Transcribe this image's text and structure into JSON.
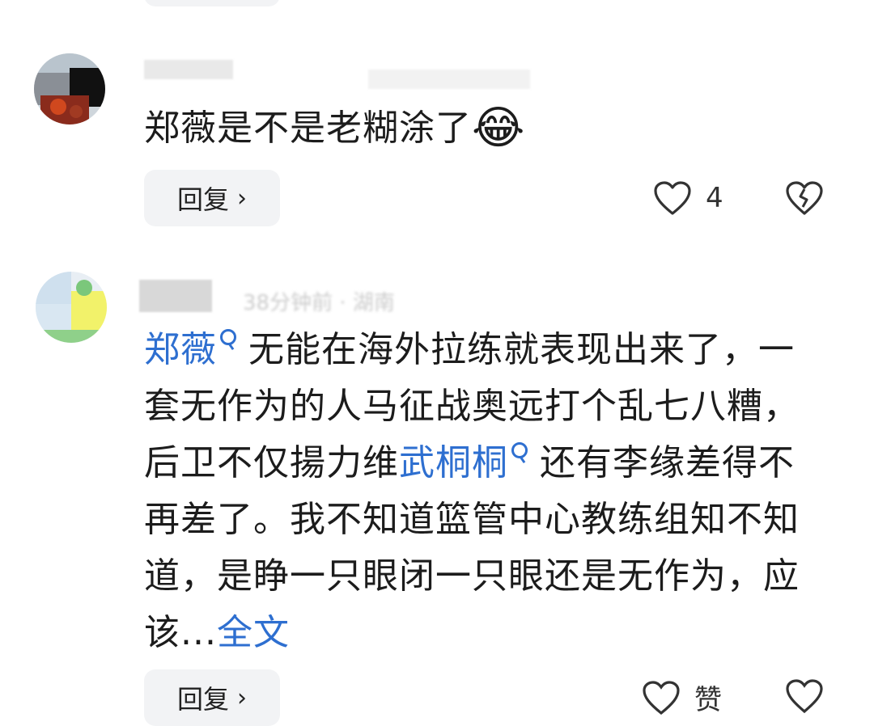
{
  "comments": [
    {
      "author": "",
      "text": "郑薇是不是老糊涂了",
      "emoji": "😂",
      "reply_label": "回复",
      "reply_chevron": "›",
      "like_count": "4",
      "like_icon": "heart-icon",
      "dislike_icon": "broken-heart-icon"
    },
    {
      "author": "",
      "meta": "38分钟前 · 湖南",
      "mention1": "郑薇",
      "text1": "无能在海外拉练就表现出来了，一套无作为的人马征战奥远打个乱七八糟，后卫不仅揚力维",
      "mention2": "武桐桐",
      "text2": "还有李缘差得不再差了。我不知道篮管中心教练组知不知道，是睁一只眼闭一只眼还是无作为，应该...",
      "more_label": "全文",
      "reply_label": "回复",
      "reply_chevron": "›",
      "like_count": "赞"
    }
  ],
  "colors": {
    "link": "#2e6fd0",
    "button_bg": "#f2f3f5",
    "text": "#1c1c1c"
  }
}
